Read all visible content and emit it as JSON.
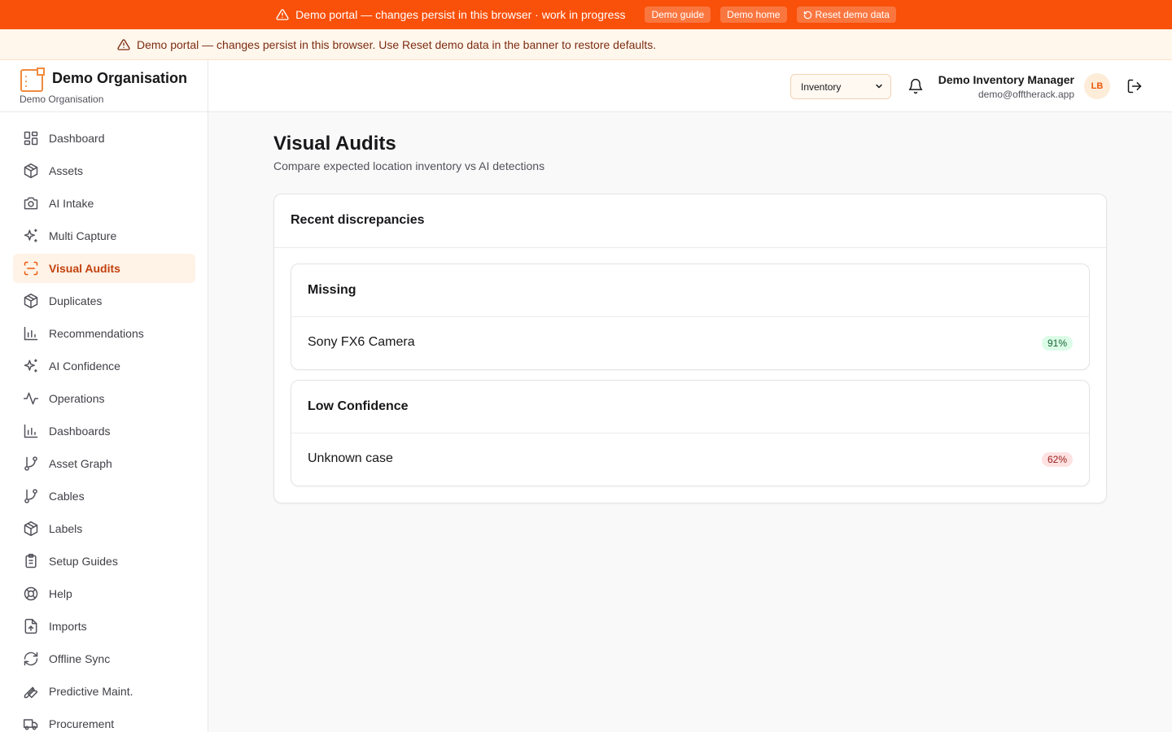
{
  "top_banner": {
    "message": "Demo portal — changes persist in this browser · work in progress",
    "demo_guide": "Demo guide",
    "demo_home": "Demo home",
    "reset": "Reset demo data"
  },
  "notice": {
    "message": "Demo portal — changes persist in this browser. Use Reset demo data in the banner to restore defaults."
  },
  "org": {
    "name": "Demo Organisation",
    "subtitle": "Demo Organisation"
  },
  "sidebar": {
    "items": [
      {
        "label": "Dashboard",
        "icon": "dashboard-icon"
      },
      {
        "label": "Assets",
        "icon": "box-icon"
      },
      {
        "label": "AI Intake",
        "icon": "camera-icon"
      },
      {
        "label": "Multi Capture",
        "icon": "sparkles-icon"
      },
      {
        "label": "Visual Audits",
        "icon": "scan-icon",
        "active": true
      },
      {
        "label": "Duplicates",
        "icon": "box-icon"
      },
      {
        "label": "Recommendations",
        "icon": "bar-chart-icon"
      },
      {
        "label": "AI Confidence",
        "icon": "sparkles-icon"
      },
      {
        "label": "Operations",
        "icon": "activity-icon"
      },
      {
        "label": "Dashboards",
        "icon": "bar-chart-icon"
      },
      {
        "label": "Asset Graph",
        "icon": "git-branch-icon"
      },
      {
        "label": "Cables",
        "icon": "git-branch-icon"
      },
      {
        "label": "Labels",
        "icon": "box-icon"
      },
      {
        "label": "Setup Guides",
        "icon": "clipboard-icon"
      },
      {
        "label": "Help",
        "icon": "life-buoy-icon"
      },
      {
        "label": "Imports",
        "icon": "file-upload-icon"
      },
      {
        "label": "Offline Sync",
        "icon": "refresh-icon"
      },
      {
        "label": "Predictive Maint.",
        "icon": "wrench-icon"
      },
      {
        "label": "Procurement",
        "icon": "truck-icon"
      }
    ]
  },
  "header": {
    "module_select": "Inventory",
    "user_name": "Demo Inventory Manager",
    "user_email": "demo@offtherack.app",
    "avatar_initials": "LB"
  },
  "page": {
    "title": "Visual Audits",
    "subtitle": "Compare expected location inventory vs AI detections"
  },
  "discrepancies": {
    "title": "Recent discrepancies",
    "groups": [
      {
        "label": "Missing",
        "item": "Sony FX6 Camera",
        "confidence": "91%",
        "badge_color": "#dcfce7"
      },
      {
        "label": "Low Confidence",
        "item": "Unknown case",
        "confidence": "62%",
        "badge_color": "#fee2e2"
      }
    ]
  },
  "colors": {
    "brand": "#f9500a",
    "accent": "#ea580c"
  }
}
